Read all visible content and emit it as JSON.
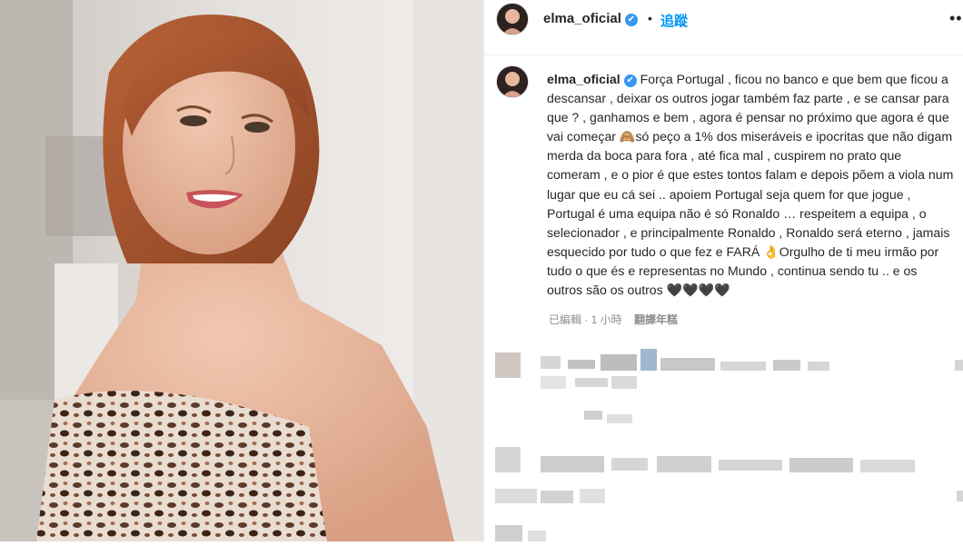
{
  "post": {
    "username": "elma_oficial",
    "verified_glyph": "✔",
    "separator": "•",
    "follow_label": "追蹤",
    "more_label": "•••"
  },
  "caption": {
    "username": "elma_oficial",
    "text": "Força Portugal , ficou no banco e que bem que ficou a descansar , deixar os outros jogar também faz parte , e se cansar para que ? , ganhamos e bem , agora é pensar no próximo que agora é que vai começar 🙈só peço a 1% dos miseráveis e ipocritas que não digam merda da boca para fora , até fica mal , cuspirem no prato que comeram , e o pior é que estes tontos falam e depois põem a viola num lugar que eu cá sei .. apoiem Portugal seja quem for que jogue , Portugal é uma equipa não é só Ronaldo … respeitem a equipa , o selecionador , e principalmente Ronaldo , Ronaldo será eterno , jamais esquecido por tudo o que fez e FARÁ 👌Orgulho de ti meu irmão por tudo o que és e representas no Mundo , continua sendo tu .. e os outros são os outros 🖤🖤🖤🖤"
  },
  "meta": {
    "edited": "已編輯 · 1 小時",
    "translate": "翻譯年糕"
  },
  "icons": {
    "verified": "verified-badge-icon",
    "more": "more-options-icon"
  },
  "colors": {
    "link": "#0095f6",
    "verified": "#3897f0",
    "muted": "#8e8e8e"
  }
}
